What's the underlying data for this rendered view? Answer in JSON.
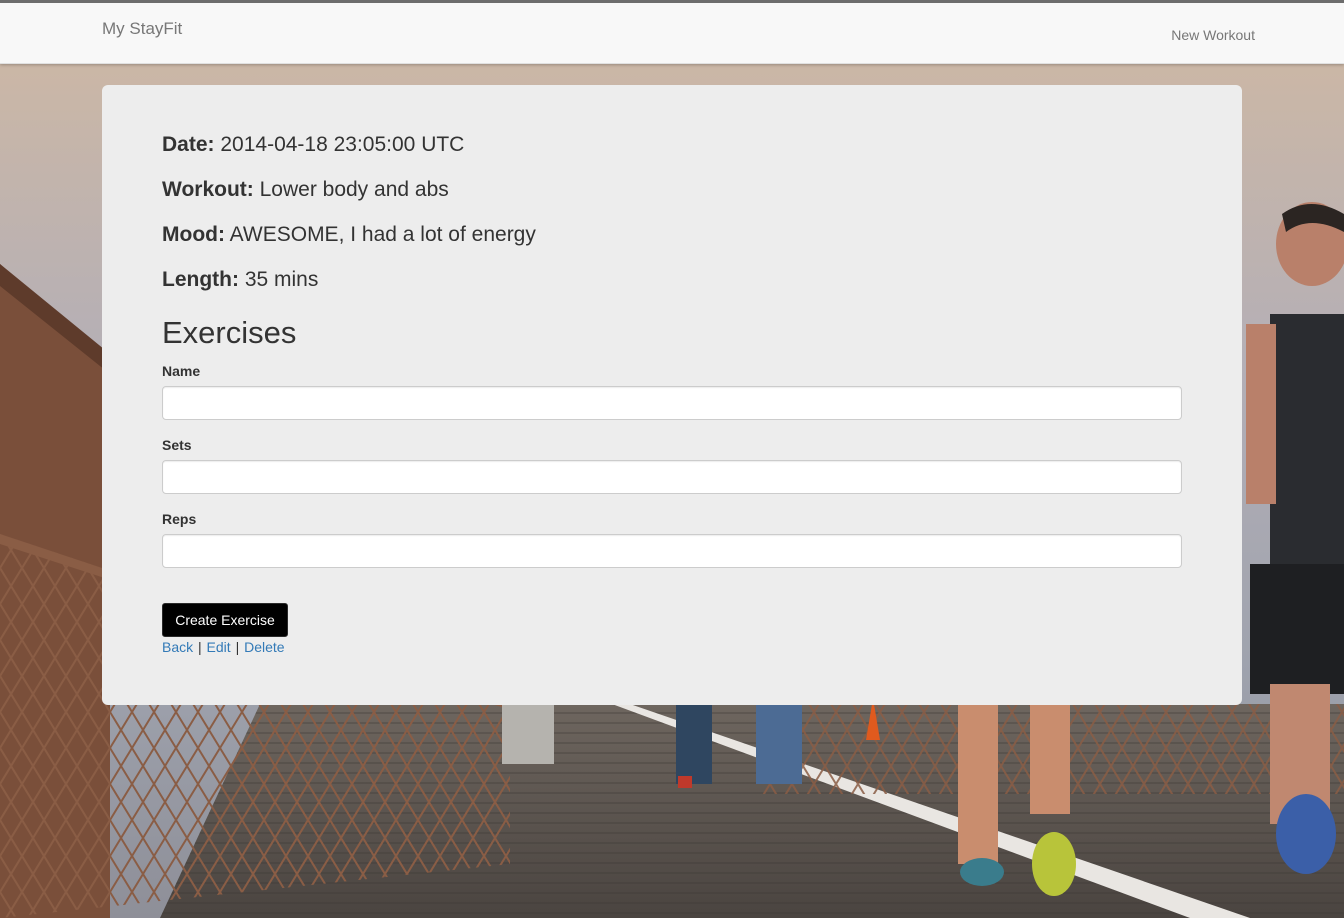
{
  "navbar": {
    "brand": "My StayFit",
    "new_workout_link": "New Workout"
  },
  "workout": {
    "date_label": "Date:",
    "date_value": "2014-04-18 23:05:00 UTC",
    "workout_label": "Workout:",
    "workout_value": "Lower body and abs",
    "mood_label": "Mood:",
    "mood_value": "AWESOME, I had a lot of energy",
    "length_label": "Length:",
    "length_value": "35 mins"
  },
  "exercise_form": {
    "title": "Exercises",
    "name_label": "Name",
    "name_value": "",
    "sets_label": "Sets",
    "sets_value": "",
    "reps_label": "Reps",
    "reps_value": "",
    "submit_label": "Create Exercise"
  },
  "links": {
    "back": "Back",
    "separator": "|",
    "edit": "Edit",
    "delete": "Delete"
  },
  "colors": {
    "navbar_bg": "#f8f8f8",
    "panel_bg": "#ededed",
    "link": "#337ab7",
    "button_bg": "#000000",
    "text": "#333333"
  },
  "background": {
    "icon": "running-bridge-photo"
  }
}
